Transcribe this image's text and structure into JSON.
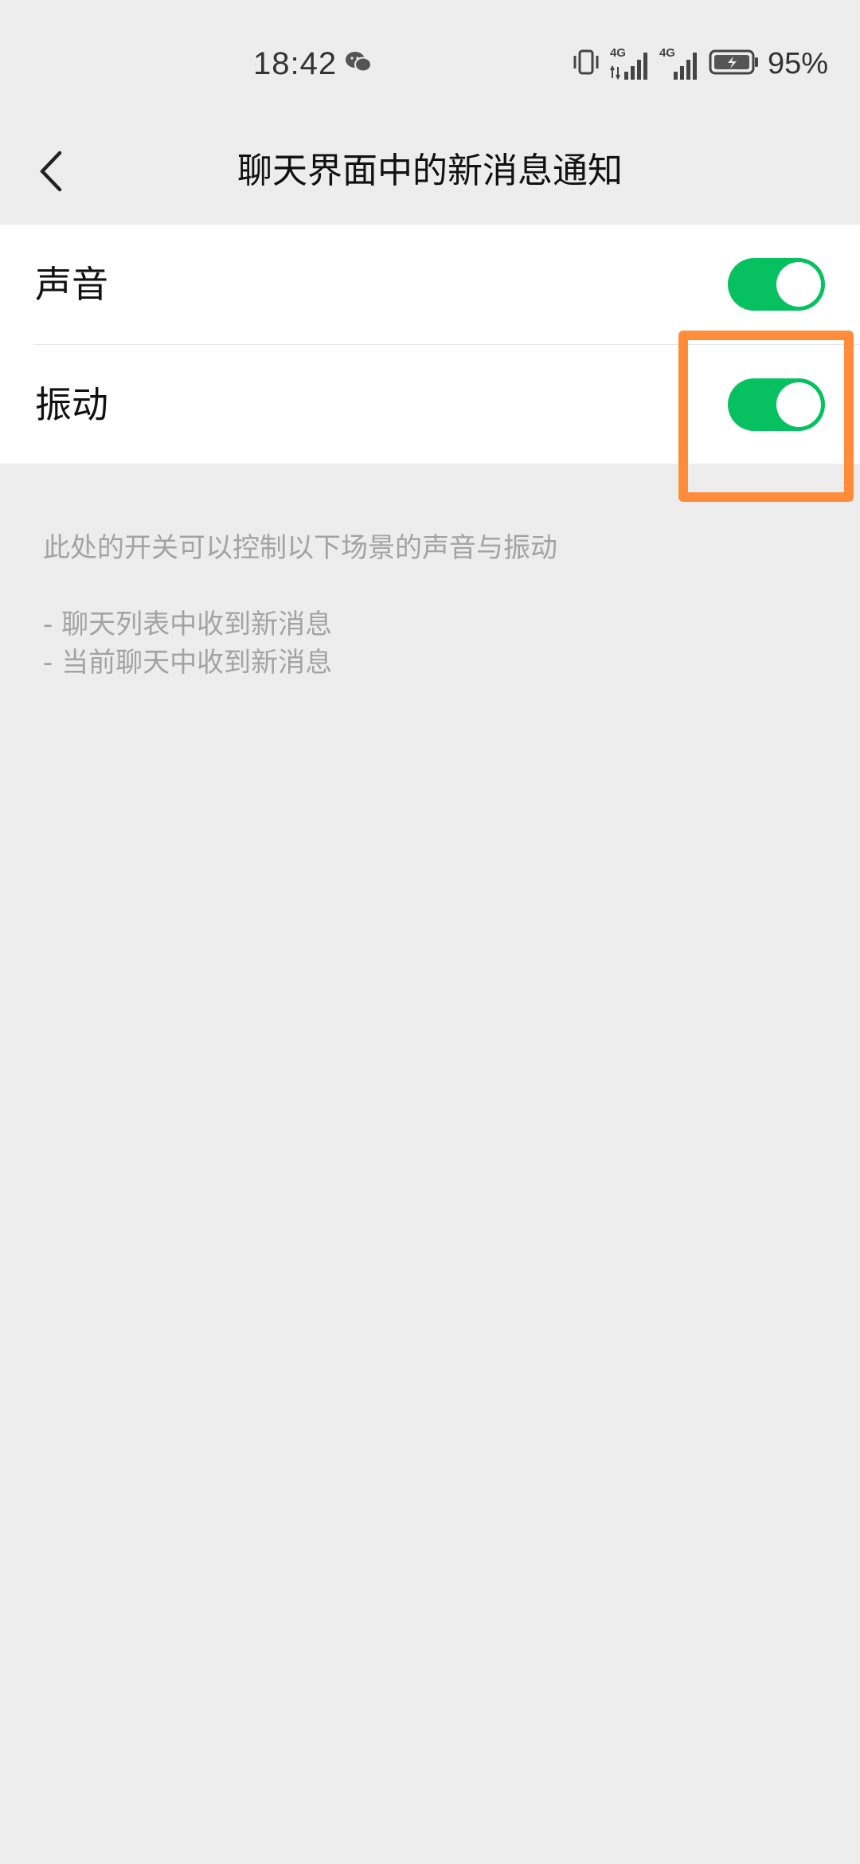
{
  "status_bar": {
    "time": "18:42",
    "notification_icon": "wechat-icon",
    "network_labels": [
      "4G",
      "4G"
    ],
    "battery_percent": "95%"
  },
  "header": {
    "title": "聊天界面中的新消息通知",
    "back_icon": "chevron-left-icon"
  },
  "settings": {
    "sound": {
      "label": "声音",
      "enabled": true
    },
    "vibration": {
      "label": "振动",
      "enabled": true
    }
  },
  "description": {
    "intro": "此处的开关可以控制以下场景的声音与振动",
    "items": [
      "- 聊天列表中收到新消息",
      "- 当前聊天中收到新消息"
    ]
  },
  "colors": {
    "toggle_on": "#07c160",
    "highlight": "#ff8c3a",
    "background": "#ededed"
  }
}
